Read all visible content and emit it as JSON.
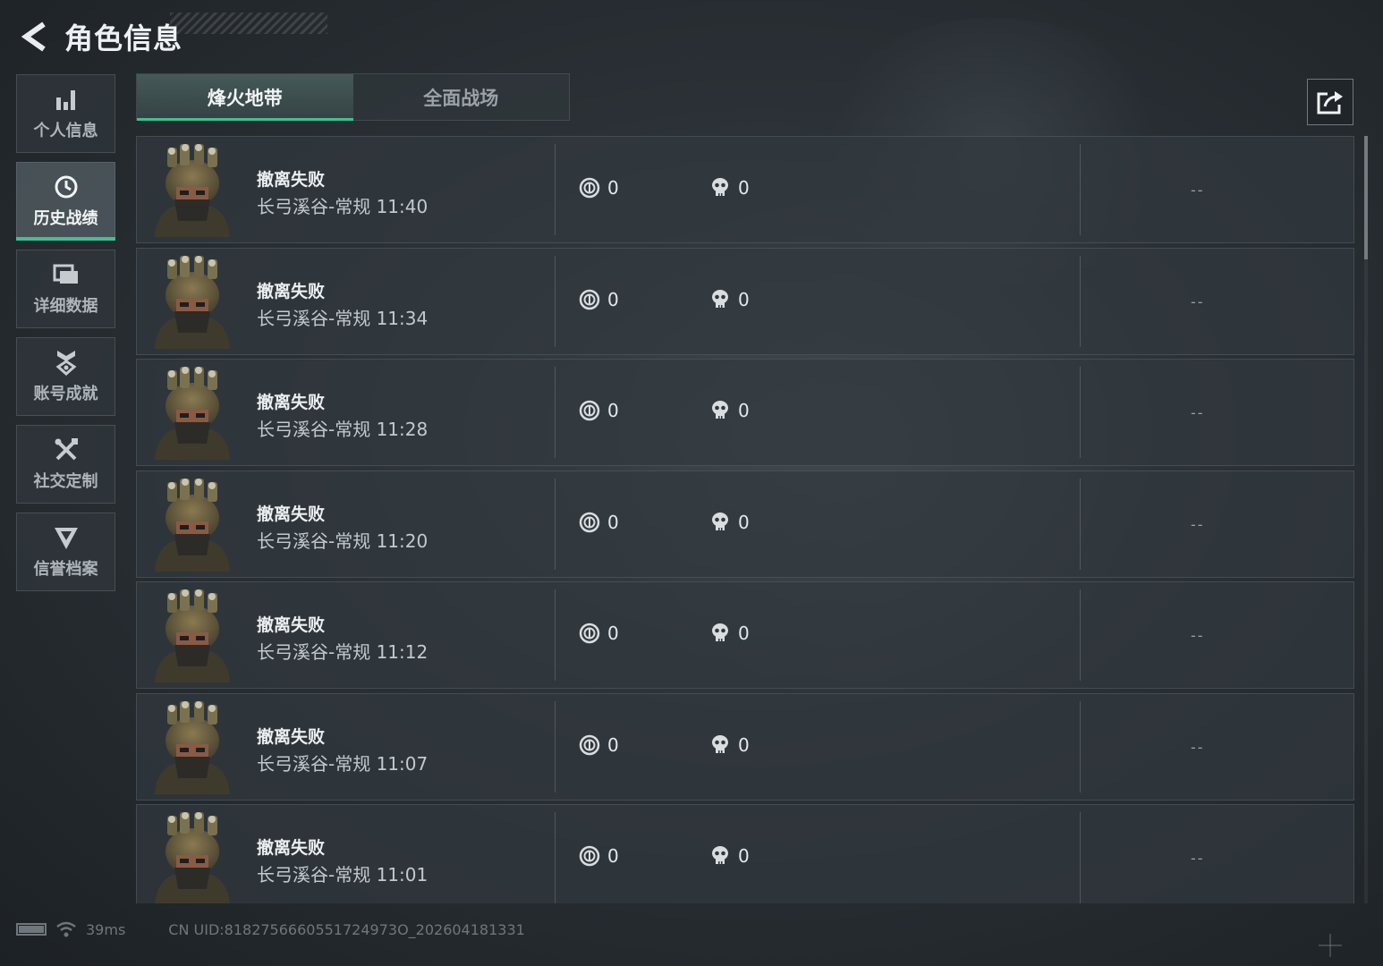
{
  "header": {
    "title": "角色信息"
  },
  "sidebar": {
    "items": [
      {
        "label": "个人信息",
        "icon": "bar-chart-icon",
        "active": false
      },
      {
        "label": "历史战绩",
        "icon": "clock-icon",
        "active": true
      },
      {
        "label": "详细数据",
        "icon": "folder-icon",
        "active": false
      },
      {
        "label": "账号成就",
        "icon": "medal-icon",
        "active": false
      },
      {
        "label": "社交定制",
        "icon": "crossed-tools-icon",
        "active": false
      },
      {
        "label": "信誉档案",
        "icon": "shield-emblem-icon",
        "active": false
      }
    ]
  },
  "tabs": [
    {
      "label": "烽火地带",
      "active": true
    },
    {
      "label": "全面战场",
      "active": false
    }
  ],
  "accent_color": "#3ec28f",
  "matches": [
    {
      "status": "撤离失败",
      "map": "长弓溪谷-常规",
      "time": "11:40",
      "coins": "0",
      "kills": "0",
      "extra": "--"
    },
    {
      "status": "撤离失败",
      "map": "长弓溪谷-常规",
      "time": "11:34",
      "coins": "0",
      "kills": "0",
      "extra": "--"
    },
    {
      "status": "撤离失败",
      "map": "长弓溪谷-常规",
      "time": "11:28",
      "coins": "0",
      "kills": "0",
      "extra": "--"
    },
    {
      "status": "撤离失败",
      "map": "长弓溪谷-常规",
      "time": "11:20",
      "coins": "0",
      "kills": "0",
      "extra": "--"
    },
    {
      "status": "撤离失败",
      "map": "长弓溪谷-常规",
      "time": "11:12",
      "coins": "0",
      "kills": "0",
      "extra": "--"
    },
    {
      "status": "撤离失败",
      "map": "长弓溪谷-常规",
      "time": "11:07",
      "coins": "0",
      "kills": "0",
      "extra": "--"
    },
    {
      "status": "撤离失败",
      "map": "长弓溪谷-常规",
      "time": "11:01",
      "coins": "0",
      "kills": "0",
      "extra": "--"
    }
  ],
  "footer": {
    "ping": "39ms",
    "uid": "CN UID:8182756660551724973O_202604181331"
  }
}
